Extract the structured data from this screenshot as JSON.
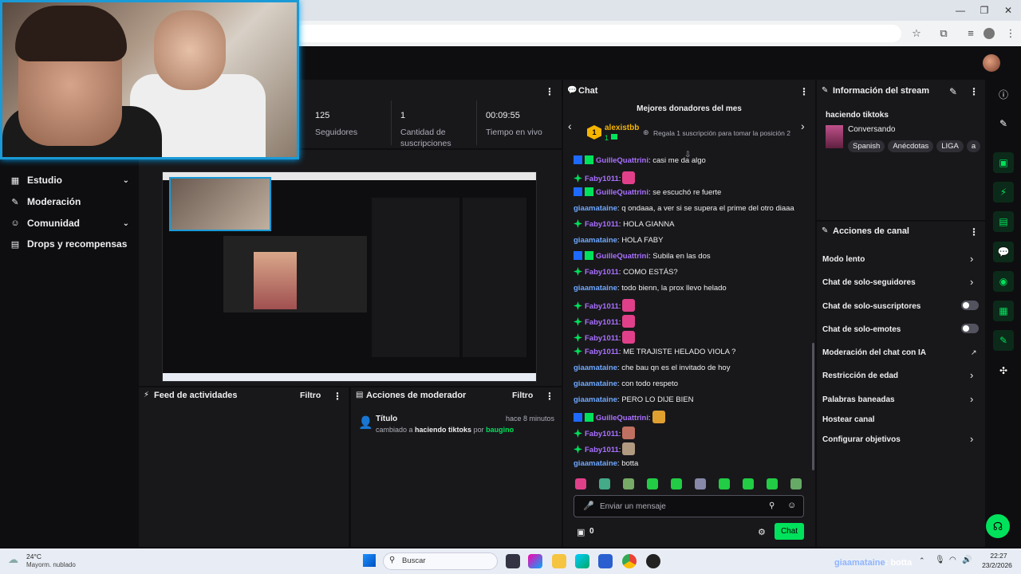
{
  "stats": [
    {
      "value": "125",
      "label": "Seguidores"
    },
    {
      "value": "1",
      "label": "Cantidad de suscripciones"
    },
    {
      "value": "00:09:55",
      "label": "Tiempo en vivo"
    }
  ],
  "nav": {
    "items": [
      {
        "label": "Estudio",
        "has_chevron": true
      },
      {
        "label": "Moderación",
        "has_chevron": false
      },
      {
        "label": "Comunidad",
        "has_chevron": true
      },
      {
        "label": "Drops y recompensas",
        "has_chevron": false
      }
    ]
  },
  "activity_feed": {
    "title": "Feed de actividades",
    "filter": "Filtro"
  },
  "mod_actions": {
    "title": "Acciones de moderador",
    "filter": "Filtro",
    "entry": {
      "title": "Título",
      "time": "hace 8 minutos",
      "text_prefix": "cambiado a",
      "value": "haciendo tiktoks",
      "by": "por",
      "user": "baugino"
    }
  },
  "chat": {
    "title": "Chat",
    "donors_title": "Mejores donadores del mes",
    "top_donor": {
      "rank": "1",
      "name": "alexistbb",
      "count": "1"
    },
    "gift_prompt": "Regala 1 suscripción para tomar la posición 2",
    "messages": [
      {
        "user": "GuilleQuattrini",
        "color": "#a970ff",
        "text": ": casi me da algo",
        "emote": null
      },
      {
        "user": "Faby1011",
        "color": "#a970ff",
        "text": ":",
        "emote": "heart"
      },
      {
        "user": "GuilleQuattrini",
        "color": "#a970ff",
        "text": ": se escuchó re fuerte",
        "emote": null
      },
      {
        "user": "giaamataine",
        "color": "#6ea8ff",
        "text": ": q ondaaa, a ver si se supera el prime del otro diaaa",
        "emote": null
      },
      {
        "user": "Faby1011",
        "color": "#a970ff",
        "text": ": HOLA GIANNA",
        "emote": null
      },
      {
        "user": "giaamataine",
        "color": "#6ea8ff",
        "text": ": HOLA FABY",
        "emote": null
      },
      {
        "user": "GuilleQuattrini",
        "color": "#a970ff",
        "text": ": Subila en las dos",
        "emote": null
      },
      {
        "user": "Faby1011",
        "color": "#a970ff",
        "text": ": COMO ESTÁS?",
        "emote": null
      },
      {
        "user": "giaamataine",
        "color": "#6ea8ff",
        "text": ": todo bienn, la prox llevo helado",
        "emote": null
      },
      {
        "user": "Faby1011",
        "color": "#a970ff",
        "text": ":",
        "emote": "heart"
      },
      {
        "user": "Faby1011",
        "color": "#a970ff",
        "text": ":",
        "emote": "heart"
      },
      {
        "user": "Faby1011",
        "color": "#a970ff",
        "text": ":",
        "emote": "heart"
      },
      {
        "user": "Faby1011",
        "color": "#a970ff",
        "text": ": ME TRAJISTE HELADO VIOLA ?",
        "emote": null
      },
      {
        "user": "giaamataine",
        "color": "#6ea8ff",
        "text": ": che bau qn es el invitado de hoy",
        "emote": null
      },
      {
        "user": "giaamataine",
        "color": "#6ea8ff",
        "text": ": con todo respeto",
        "emote": null
      },
      {
        "user": "giaamataine",
        "color": "#6ea8ff",
        "text": ": PERO LO DIJE BIEN",
        "emote": null
      },
      {
        "user": "GuilleQuattrini",
        "color": "#a970ff",
        "text": ":",
        "emote": "cat"
      },
      {
        "user": "Faby1011",
        "color": "#a970ff",
        "text": ":",
        "emote": "face"
      },
      {
        "user": "Faby1011",
        "color": "#a970ff",
        "text": ":",
        "emote": "photo"
      },
      {
        "user": "giaamataine",
        "color": "#6ea8ff",
        "text": ": botta",
        "emote": null
      }
    ],
    "input_placeholder": "Enviar un mensaje",
    "points": "0",
    "send_label": "Chat"
  },
  "stream_info": {
    "title": "Información del stream",
    "stream_title": "haciendo tiktoks",
    "category": "Conversando",
    "tags": [
      "Spanish",
      "Anécdotas",
      "LIGA",
      "a"
    ]
  },
  "channel_actions": {
    "title": "Acciones de canal",
    "items": [
      {
        "label": "Modo lento",
        "control": "chevron"
      },
      {
        "label": "Chat de solo-seguidores",
        "control": "chevron"
      },
      {
        "label": "Chat de solo-suscriptores",
        "control": "toggle"
      },
      {
        "label": "Chat de solo-emotes",
        "control": "toggle"
      },
      {
        "label": "Moderación del chat con IA",
        "control": "external"
      },
      {
        "label": "Restricción de edad",
        "control": "chevron"
      },
      {
        "label": "Palabras baneadas",
        "control": "chevron"
      },
      {
        "label": "Hostear canal",
        "control": "none"
      },
      {
        "label": "Configurar objetivos",
        "control": "chevron"
      }
    ]
  },
  "taskbar": {
    "weather_temp": "24°C",
    "weather_desc": "Mayorm. nublado",
    "search_placeholder": "Buscar",
    "overlay_user": "giaamataine",
    "overlay_text": ": botta",
    "time": "22:27",
    "date": "23/2/2026"
  },
  "colors": {
    "accent": "#00e25b",
    "purple": "#a970ff",
    "panel": "#18181b",
    "background": "#0e0e10"
  }
}
